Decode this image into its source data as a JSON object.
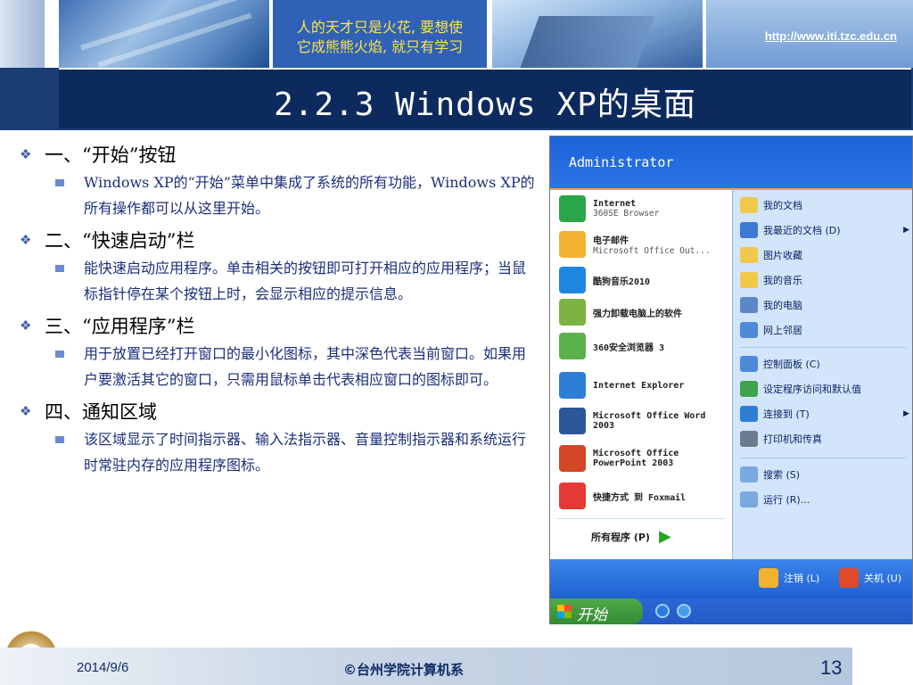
{
  "banner": {
    "motto_line1": "人的天才只是火花, 要想使",
    "motto_line2": "它成熊熊火焰, 就只有学习",
    "url": "http://www.iti.tzc.edu.cn"
  },
  "slide": {
    "title": "2.2.3 Windows XP的桌面"
  },
  "sections": [
    {
      "heading": "一、“开始”按钮",
      "body": "Windows XP的“开始”菜单中集成了系统的所有功能，Windows XP的所有操作都可以从这里开始。"
    },
    {
      "heading": "二、“快速启动”栏",
      "body": "能快速启动应用程序。单击相关的按钮即可打开相应的应用程序；当鼠标指针停在某个按钮上时，会显示相应的提示信息。"
    },
    {
      "heading": "三、“应用程序”栏",
      "body": "用于放置已经打开窗口的最小化图标，其中深色代表当前窗口。如果用户要激活其它的窗口，只需用鼠标单击代表相应窗口的图标即可。"
    },
    {
      "heading": "四、通知区域",
      "body": "该区域显示了时间指示器、输入法指示器、音量控制指示器和系统运行时常驻内存的应用程序图标。"
    }
  ],
  "startmenu": {
    "user": "Administrator",
    "left_items": [
      {
        "t1": "Internet",
        "t2": "360SE Browser",
        "icon": "ie-360-icon",
        "color": "#2aa547"
      },
      {
        "t1": "电子邮件",
        "t2": "Microsoft Office Out...",
        "icon": "outlook-icon",
        "color": "#f2b230"
      },
      {
        "t1": "酷狗音乐2010",
        "t2": "",
        "icon": "kugou-icon",
        "color": "#1e86e0"
      },
      {
        "t1": "强力卸载电脑上的软件",
        "t2": "",
        "icon": "uninstall-icon",
        "color": "#7cb342"
      },
      {
        "t1": "360安全浏览器 3",
        "t2": "",
        "icon": "360-browser-icon",
        "color": "#5bb14a"
      },
      {
        "t1": "Internet Explorer",
        "t2": "",
        "icon": "ie-icon",
        "color": "#2e7ed6"
      },
      {
        "t1": "Microsoft Office Word 2003",
        "t2": "",
        "icon": "word-icon",
        "color": "#2b579a"
      },
      {
        "t1": "Microsoft Office PowerPoint 2003",
        "t2": "",
        "icon": "powerpoint-icon",
        "color": "#d24726"
      },
      {
        "t1": "快捷方式 到 Foxmail",
        "t2": "",
        "icon": "foxmail-icon",
        "color": "#e53935"
      }
    ],
    "all_programs": "所有程序 (P)",
    "right_items": [
      {
        "label": "我的文档",
        "icon": "my-documents-icon",
        "arrow": false
      },
      {
        "label": "我最近的文档 (D)",
        "icon": "recent-docs-icon",
        "arrow": true
      },
      {
        "label": "图片收藏",
        "icon": "my-pictures-icon",
        "arrow": false
      },
      {
        "label": "我的音乐",
        "icon": "my-music-icon",
        "arrow": false
      },
      {
        "label": "我的电脑",
        "icon": "my-computer-icon",
        "arrow": false
      },
      {
        "label": "网上邻居",
        "icon": "network-icon",
        "arrow": false
      },
      {
        "label": "控制面板 (C)",
        "icon": "control-panel-icon",
        "arrow": false
      },
      {
        "label": "设定程序访问和默认值",
        "icon": "defaults-icon",
        "arrow": false
      },
      {
        "label": "连接到 (T)",
        "icon": "connect-icon",
        "arrow": true
      },
      {
        "label": "打印机和传真",
        "icon": "printer-icon",
        "arrow": false
      },
      {
        "label": "搜索 (S)",
        "icon": "search-icon",
        "arrow": false
      },
      {
        "label": "运行 (R)...",
        "icon": "run-icon",
        "arrow": false
      }
    ],
    "logoff": "注销 (L)",
    "shutdown": "关机 (U)",
    "start_label": "开始"
  },
  "footer": {
    "date": "2014/9/6",
    "copyright": "©台州学院计算机系",
    "page": "13"
  }
}
